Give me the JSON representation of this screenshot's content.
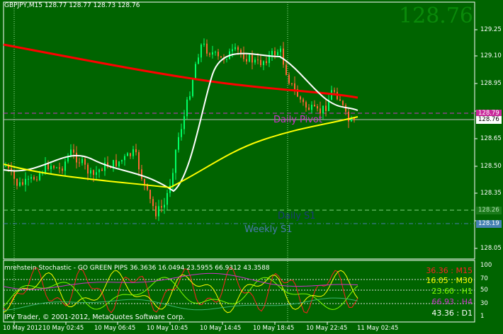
{
  "window": {
    "title": "GBPJPY,M15  128.77 128.77 128.73 128.76",
    "last_price_big": "128.76",
    "copyright": "IPV Trader, © 2001-2012, MetaQuotes Software Corp."
  },
  "price_axis": [
    "129.25",
    "129.10",
    "128.95",
    "128.80",
    "128.65",
    "128.50",
    "128.35",
    "128.20",
    "128.05"
  ],
  "price_tags": {
    "pivot": {
      "text": "128.79",
      "bg": "#c8289a",
      "fg": "#ffffff"
    },
    "current": {
      "text": "128.76",
      "bg": "#ffffff",
      "fg": "#000000"
    },
    "daily_s1": {
      "text": "128.26",
      "bg": "#1a7a1a",
      "fg": "#b0e0b0"
    },
    "weekly_s1": {
      "text": "128.19",
      "bg": "#4682b4",
      "fg": "#ffffff"
    }
  },
  "levels": {
    "daily_pivot": {
      "label": "Daily Pivot",
      "color": "#cc33cc"
    },
    "daily_s1": {
      "label": "Daily S1",
      "color": "#1a3a7a"
    },
    "weekly_s1": {
      "label": "Weekly S1",
      "color": "#4a7ab0"
    }
  },
  "time_axis": [
    "10 May 2012",
    "10 May 02:45",
    "10 May 06:45",
    "10 May 10:45",
    "10 May 14:45",
    "10 May 18:45",
    "10 May 22:45",
    "11 May 02:45"
  ],
  "indicator": {
    "title": "mrehstein Stochastic - GO GREEN PIPS 36.3636 16.0494 23.5955 66.9312 43.3588",
    "axis": [
      "100",
      "70",
      "50",
      "30",
      "1"
    ],
    "timeframes": [
      {
        "text": "36.36 : M15",
        "color": "#ff2020"
      },
      {
        "text": "16.05 : M30",
        "color": "#ffff00"
      },
      {
        "text": "23.60 : H1",
        "color": "#7cfc00"
      },
      {
        "text": "66.93 : H4",
        "color": "#cc33cc"
      },
      {
        "text": "43.36 : D1",
        "color": "#ffffff"
      }
    ]
  },
  "colors": {
    "background": "#006400",
    "bull_candle": "#00ff66",
    "bear_candle": "#ff6633",
    "ma_red": "#ff0000",
    "ma_white": "#ffffff",
    "ma_yellow": "#ffff00",
    "grid": "#7fd47f"
  }
}
